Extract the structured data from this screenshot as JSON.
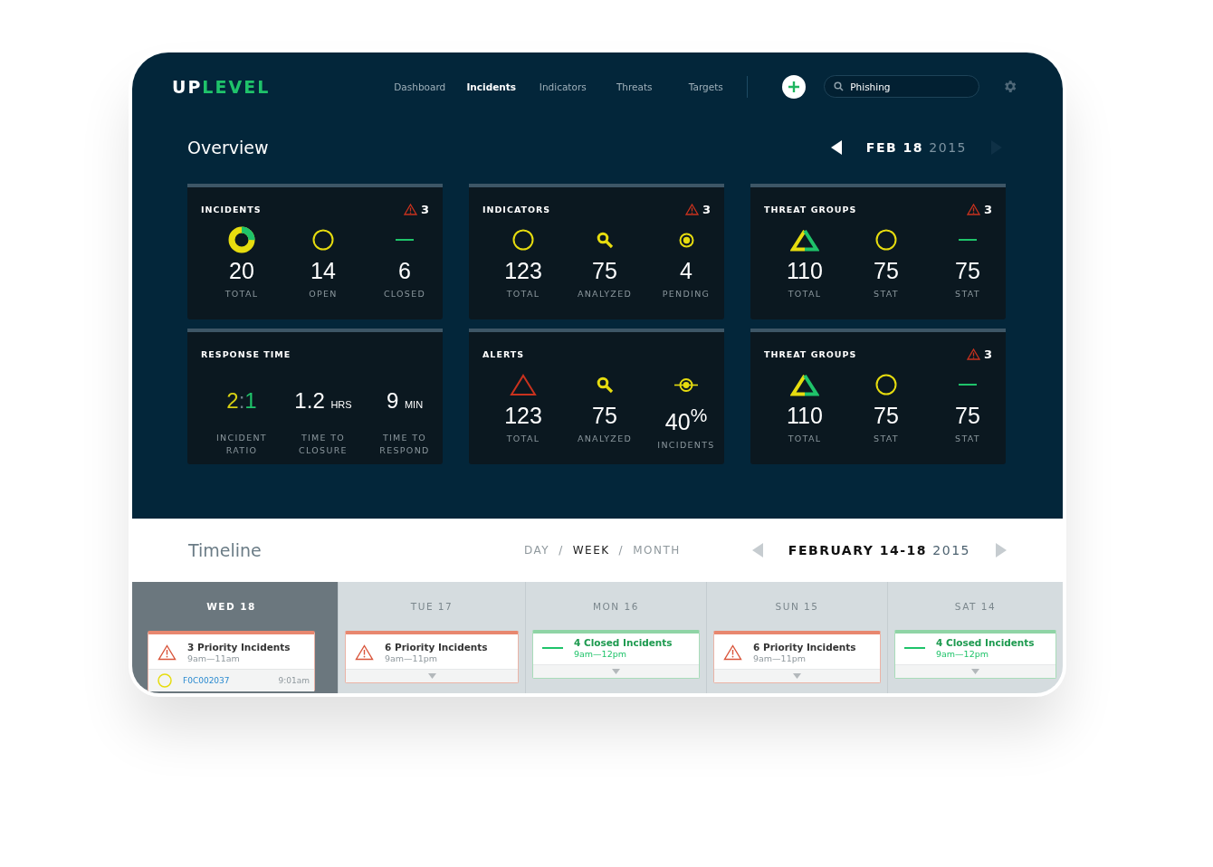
{
  "logo": {
    "lead": "UP",
    "rest": "LEVEL"
  },
  "nav": [
    {
      "label": "Dashboard",
      "selected": false
    },
    {
      "label": "Incidents",
      "selected": true
    },
    {
      "label": "Indicators",
      "selected": false
    },
    {
      "label": "Threats",
      "selected": false
    },
    {
      "label": "Targets",
      "selected": false
    }
  ],
  "search": {
    "value": "Phishing"
  },
  "overview": {
    "title": "Overview",
    "date": "FEB 18",
    "year": "2015"
  },
  "cards": [
    {
      "title": "INCIDENTS",
      "alerts": "3",
      "stats": [
        {
          "kind": "donut",
          "value": "20",
          "label": "TOTAL"
        },
        {
          "kind": "circle",
          "value": "14",
          "label": "OPEN"
        },
        {
          "kind": "dash",
          "value": "6",
          "label": "CLOSED"
        }
      ]
    },
    {
      "title": "INDICATORS",
      "alerts": "3",
      "stats": [
        {
          "kind": "circle",
          "value": "123",
          "label": "TOTAL"
        },
        {
          "kind": "search",
          "value": "75",
          "label": "ANALYZED"
        },
        {
          "kind": "target",
          "value": "4",
          "label": "PENDING"
        }
      ]
    },
    {
      "title": "THREAT GROUPS",
      "alerts": "3",
      "stats": [
        {
          "kind": "split",
          "value": "110",
          "label": "TOTAL"
        },
        {
          "kind": "circle",
          "value": "75",
          "label": "STAT"
        },
        {
          "kind": "dash",
          "value": "75",
          "label": "STAT"
        }
      ]
    },
    {
      "title": "RESPONSE TIME",
      "stats": [
        {
          "kind": "ratio",
          "value": "2",
          "sep": ":",
          "value2": "1",
          "label": "INCIDENT RATIO"
        },
        {
          "kind": "unit",
          "value": "1.2",
          "unit": "HRS",
          "label": "TIME TO CLOSURE"
        },
        {
          "kind": "unit",
          "value": "9",
          "unit": "MIN",
          "label": "TIME TO RESPOND"
        }
      ]
    },
    {
      "title": "ALERTS",
      "stats": [
        {
          "kind": "triangle",
          "value": "123",
          "label": "TOTAL"
        },
        {
          "kind": "search",
          "value": "75",
          "label": "ANALYZED"
        },
        {
          "kind": "crosshair",
          "value": "40$^{%}$",
          "label": "INCIDENTS"
        }
      ]
    },
    {
      "title": "THREAT GROUPS",
      "alerts": "3",
      "stats": [
        {
          "kind": "split",
          "value": "110",
          "label": "TOTAL"
        },
        {
          "kind": "circle",
          "value": "75",
          "label": "STAT"
        },
        {
          "kind": "dash",
          "value": "75",
          "label": "STAT"
        }
      ]
    }
  ],
  "timeline": {
    "title": "Timeline",
    "periods": [
      {
        "label": "DAY",
        "selected": false,
        "separator": "/"
      },
      {
        "label": "WEEK",
        "selected": true,
        "separator": "/"
      },
      {
        "label": "MONTH",
        "selected": false
      }
    ],
    "range": "FEBRUARY 14-18",
    "year": "2015",
    "days": [
      {
        "label": "WED 18",
        "selected": true,
        "events": [
          {
            "kind": "priority",
            "title": "3 Priority Incidents",
            "time": "9am—11am",
            "expanded": true,
            "items": [
              {
                "id": "F0C002037",
                "time": "9:01am"
              }
            ]
          }
        ]
      },
      {
        "label": "TUE 17",
        "selected": false,
        "events": [
          {
            "kind": "priority",
            "title": "6 Priority Incidents",
            "time": "9am—11pm",
            "expanded": false
          }
        ]
      },
      {
        "label": "MON 16",
        "selected": false,
        "events": [
          {
            "kind": "closed",
            "title": "4 Closed Incidents",
            "time": "9am—12pm",
            "expanded": false
          }
        ]
      },
      {
        "label": "SUN 15",
        "selected": false,
        "events": [
          {
            "kind": "priority",
            "title": "6 Priority Incidents",
            "time": "9am—11pm",
            "expanded": false
          }
        ]
      },
      {
        "label": "SAT 14",
        "selected": false,
        "events": [
          {
            "kind": "closed",
            "title": "4 Closed Incidents",
            "time": "9am—12pm",
            "expanded": false
          }
        ]
      }
    ]
  }
}
